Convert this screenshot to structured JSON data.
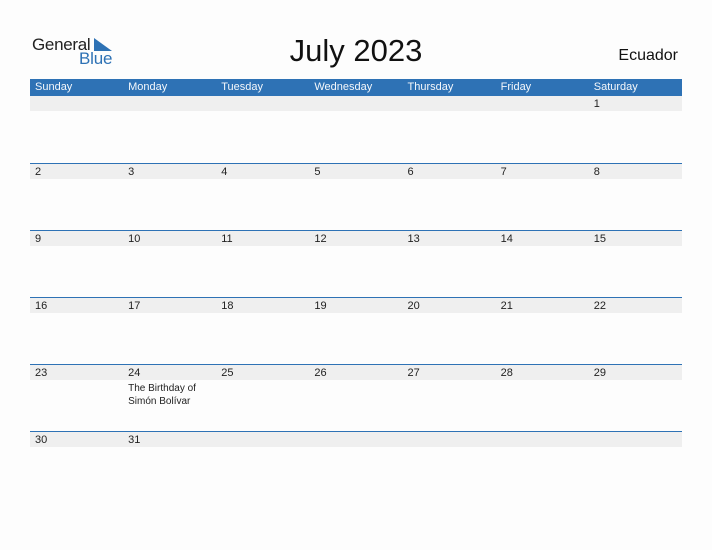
{
  "logo": {
    "line1": "General",
    "line2": "Blue",
    "icon": "triangle-flag-icon",
    "brand_color": "#2e72b5"
  },
  "title": "July 2023",
  "country": "Ecuador",
  "colors": {
    "header_bg": "#2e72b5",
    "day_strip": "#efefef",
    "separator": "#2e72b5"
  },
  "weekdays": [
    "Sunday",
    "Monday",
    "Tuesday",
    "Wednesday",
    "Thursday",
    "Friday",
    "Saturday"
  ],
  "weeks": [
    {
      "days": [
        {
          "num": "",
          "event": ""
        },
        {
          "num": "",
          "event": ""
        },
        {
          "num": "",
          "event": ""
        },
        {
          "num": "",
          "event": ""
        },
        {
          "num": "",
          "event": ""
        },
        {
          "num": "",
          "event": ""
        },
        {
          "num": "1",
          "event": ""
        }
      ]
    },
    {
      "days": [
        {
          "num": "2",
          "event": ""
        },
        {
          "num": "3",
          "event": ""
        },
        {
          "num": "4",
          "event": ""
        },
        {
          "num": "5",
          "event": ""
        },
        {
          "num": "6",
          "event": ""
        },
        {
          "num": "7",
          "event": ""
        },
        {
          "num": "8",
          "event": ""
        }
      ]
    },
    {
      "days": [
        {
          "num": "9",
          "event": ""
        },
        {
          "num": "10",
          "event": ""
        },
        {
          "num": "11",
          "event": ""
        },
        {
          "num": "12",
          "event": ""
        },
        {
          "num": "13",
          "event": ""
        },
        {
          "num": "14",
          "event": ""
        },
        {
          "num": "15",
          "event": ""
        }
      ]
    },
    {
      "days": [
        {
          "num": "16",
          "event": ""
        },
        {
          "num": "17",
          "event": ""
        },
        {
          "num": "18",
          "event": ""
        },
        {
          "num": "19",
          "event": ""
        },
        {
          "num": "20",
          "event": ""
        },
        {
          "num": "21",
          "event": ""
        },
        {
          "num": "22",
          "event": ""
        }
      ]
    },
    {
      "days": [
        {
          "num": "23",
          "event": ""
        },
        {
          "num": "24",
          "event": "The Birthday of Simón Bolívar"
        },
        {
          "num": "25",
          "event": ""
        },
        {
          "num": "26",
          "event": ""
        },
        {
          "num": "27",
          "event": ""
        },
        {
          "num": "28",
          "event": ""
        },
        {
          "num": "29",
          "event": ""
        }
      ]
    },
    {
      "days": [
        {
          "num": "30",
          "event": ""
        },
        {
          "num": "31",
          "event": ""
        },
        {
          "num": "",
          "event": ""
        },
        {
          "num": "",
          "event": ""
        },
        {
          "num": "",
          "event": ""
        },
        {
          "num": "",
          "event": ""
        },
        {
          "num": "",
          "event": ""
        }
      ]
    }
  ]
}
